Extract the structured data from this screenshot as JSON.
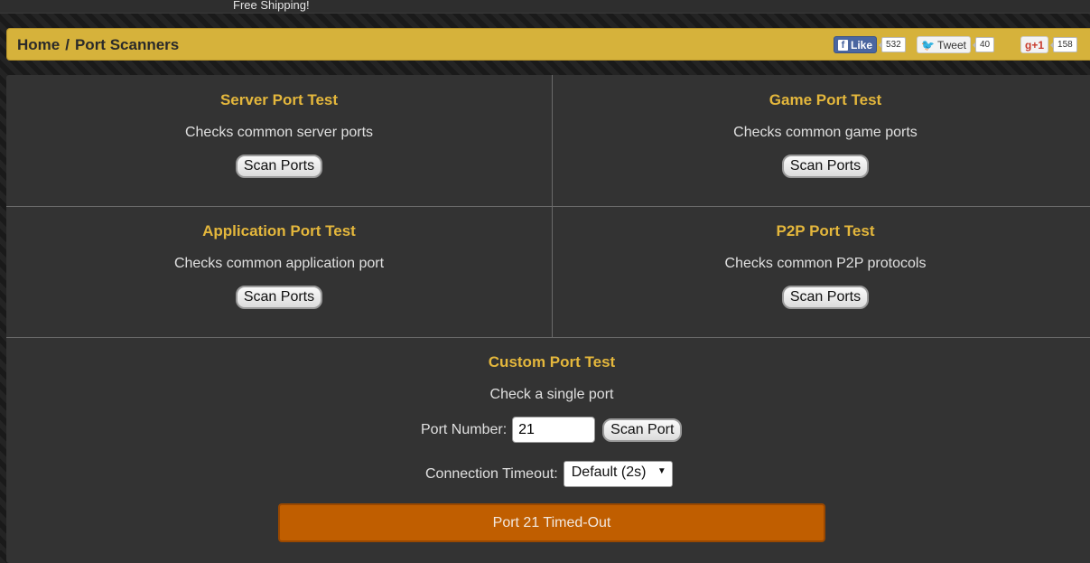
{
  "topbar": {
    "shipping_text": "Free Shipping!"
  },
  "breadcrumb": {
    "home": "Home",
    "separator": "/",
    "current": "Port Scanners"
  },
  "social": {
    "facebook": {
      "label": "Like",
      "icon": "f",
      "count": "532"
    },
    "twitter": {
      "label": "Tweet",
      "count": "40"
    },
    "google": {
      "label": "g+1",
      "count": "158"
    }
  },
  "tests": [
    {
      "title": "Server Port Test",
      "description": "Checks common server ports",
      "button": "Scan Ports"
    },
    {
      "title": "Game Port Test",
      "description": "Checks common game ports",
      "button": "Scan Ports"
    },
    {
      "title": "Application Port Test",
      "description": "Checks common application port",
      "button": "Scan Ports"
    },
    {
      "title": "P2P Port Test",
      "description": "Checks common P2P protocols",
      "button": "Scan Ports"
    }
  ],
  "custom": {
    "title": "Custom Port Test",
    "description": "Check a single port",
    "port_label": "Port Number:",
    "port_value": "21",
    "scan_button": "Scan Port",
    "timeout_label": "Connection Timeout:",
    "timeout_selected": "Default (2s)",
    "result": "Port 21 Timed-Out"
  },
  "colors": {
    "accent": "#d6b23b",
    "title": "#e4b73c",
    "result_bg": "#c05e00"
  }
}
